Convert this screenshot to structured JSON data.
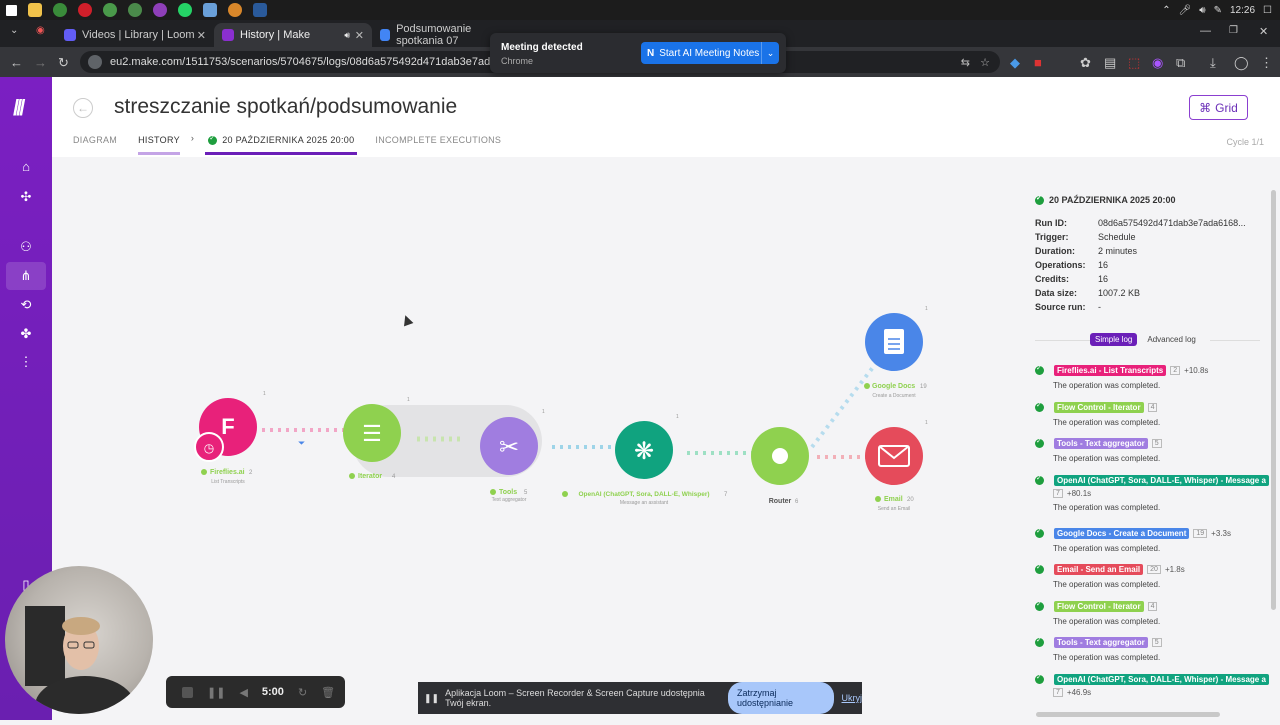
{
  "taskbar": {
    "icons": [
      "windows-icon",
      "explorer-icon",
      "chrome-icon",
      "opera-icon",
      "app-icon",
      "chrome-icon-2",
      "app-icon-2",
      "whatsapp-icon",
      "app-icon-3",
      "chrome-icon-3",
      "app-icon-4"
    ],
    "time": "12:26"
  },
  "browser": {
    "tabs": [
      {
        "label": "Videos | Library | Loom",
        "icon": "loom-icon",
        "color": "#625df5"
      },
      {
        "label": "History | Make",
        "icon": "make-icon",
        "color": "#8b2fd0"
      },
      {
        "label": "Podsumowanie spotkania 07",
        "icon": "docs-icon",
        "color": "#4285f4"
      }
    ],
    "url": "eu2.make.com/1511753/scenarios/5704675/logs/08d6a575492d471dab3e7ada61687799"
  },
  "meeting_popup": {
    "title": "Meeting detected",
    "subtitle": "Chrome",
    "button": "Start AI Meeting Notes"
  },
  "header": {
    "title": "streszczanie spotkań/podsumowanie",
    "grid_label": "Grid",
    "tabs": {
      "diagram": "DIAGRAM",
      "history": "HISTORY",
      "date": "20 PAŹDZIERNIKA 2025 20:00",
      "incomplete": "INCOMPLETE EXECUTIONS"
    },
    "cycle": "Cycle 1/1"
  },
  "canvas": {
    "modules": [
      {
        "name": "Fireflies.ai",
        "count": "2",
        "sub": "List Transcripts",
        "color": "#e8217a",
        "op": "1"
      },
      {
        "name": "Iterator",
        "count": "4",
        "sub": "",
        "color": "#8fd14f",
        "op": "1"
      },
      {
        "name": "Tools",
        "count": "5",
        "sub": "Text aggregator",
        "color": "#a07de0",
        "op": "1"
      },
      {
        "name": "OpenAI (ChatGPT, Sora, DALL-E, Whisper)",
        "count": "7",
        "sub": "Message an assistant",
        "color": "#10a37f",
        "op": "1"
      },
      {
        "name": "Router",
        "count": "6",
        "sub": "",
        "color": "#8fd14f",
        "op": ""
      },
      {
        "name": "Google Docs",
        "count": "19",
        "sub": "Create a Document",
        "color": "#4a86e8",
        "op": "1"
      },
      {
        "name": "Email",
        "count": "20",
        "sub": "Send an Email",
        "color": "#e54b5b",
        "op": "1"
      }
    ]
  },
  "run": {
    "header": "20 PAŹDZIERNIKA 2025 20:00",
    "details": [
      {
        "key": "Run ID:",
        "value": "08d6a575492d471dab3e7ada6168..."
      },
      {
        "key": "Trigger:",
        "value": "Schedule"
      },
      {
        "key": "Duration:",
        "value": "2 minutes"
      },
      {
        "key": "Operations:",
        "value": "16"
      },
      {
        "key": "Credits:",
        "value": "16"
      },
      {
        "key": "Data size:",
        "value": "1007.2 KB"
      },
      {
        "key": "Source run:",
        "value": "-"
      }
    ],
    "simple_log": "Simple log",
    "advanced_log": "Advanced log",
    "log": [
      {
        "badge": "Fireflies.ai - List Transcripts",
        "num": "2",
        "dt": "+10.8s",
        "color": "#e8217a",
        "desc": "The operation was completed."
      },
      {
        "badge": "Flow Control - Iterator",
        "num": "4",
        "dt": "",
        "color": "#8fd14f",
        "desc": "The operation was completed."
      },
      {
        "badge": "Tools - Text aggregator",
        "num": "5",
        "dt": "",
        "color": "#a07de0",
        "desc": "The operation was completed."
      },
      {
        "badge": "OpenAI (ChatGPT, Sora, DALL-E, Whisper) - Message a",
        "num": "7",
        "dt": "+80.1s",
        "color": "#10a37f",
        "desc": "The operation was completed.",
        "wrap": true
      },
      {
        "badge": "Google Docs - Create a Document",
        "num": "19",
        "dt": "+3.3s",
        "color": "#4a86e8",
        "desc": "The operation was completed."
      },
      {
        "badge": "Email - Send an Email",
        "num": "20",
        "dt": "+1.8s",
        "color": "#e54b5b",
        "desc": "The operation was completed."
      },
      {
        "badge": "Flow Control - Iterator",
        "num": "4",
        "dt": "",
        "color": "#8fd14f",
        "desc": "The operation was completed."
      },
      {
        "badge": "Tools - Text aggregator",
        "num": "5",
        "dt": "",
        "color": "#a07de0",
        "desc": "The operation was completed."
      },
      {
        "badge": "OpenAI (ChatGPT, Sora, DALL-E, Whisper) - Message a",
        "num": "7",
        "dt": "+46.9s",
        "color": "#10a37f",
        "desc": "",
        "wrap": true
      }
    ]
  },
  "recorder": {
    "time": "5:00"
  },
  "sharebar": {
    "text": "Aplikacja Loom – Screen Recorder & Screen Capture udostępnia Twój ekran.",
    "stop": "Zatrzymaj udostępnianie",
    "hide": "Ukryj"
  }
}
